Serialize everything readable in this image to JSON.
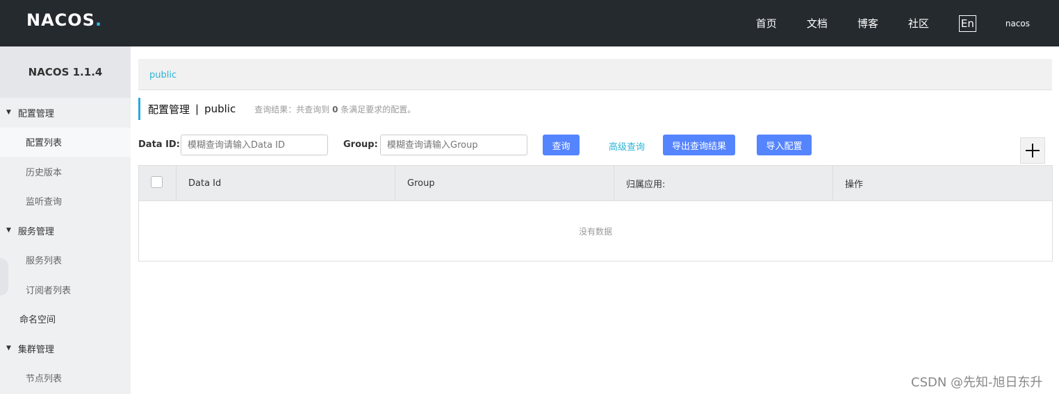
{
  "header": {
    "logo_text": "NACOS",
    "logo_dot": ".",
    "nav": [
      "首页",
      "文档",
      "博客",
      "社区"
    ],
    "lang": "En",
    "user": "nacos"
  },
  "sidebar": {
    "version": "NACOS 1.1.4",
    "menu": {
      "config_group": "配置管理",
      "config_list": "配置列表",
      "history": "历史版本",
      "listen_query": "监听查询",
      "service_group": "服务管理",
      "service_list": "服务列表",
      "subscribers": "订阅者列表",
      "namespace": "命名空间",
      "cluster_group": "集群管理",
      "node_list": "节点列表"
    }
  },
  "main": {
    "breadcrumb": "public",
    "title": "配置管理",
    "title_sep": "|",
    "namespace": "public",
    "result_prefix": "查询结果：共查询到",
    "result_count": "0",
    "result_suffix": "条满足要求的配置。",
    "form": {
      "dataid_label": "Data ID:",
      "dataid_placeholder": "模糊查询请输入Data ID",
      "group_label": "Group:",
      "group_placeholder": "模糊查询请输入Group",
      "query_btn": "查询",
      "advanced": "高级查询",
      "export_btn": "导出查询结果",
      "import_btn": "导入配置",
      "add_icon": "plus-icon"
    },
    "table": {
      "columns": [
        "Data Id",
        "Group",
        "归属应用:",
        "操作"
      ],
      "empty_text": "没有数据"
    }
  },
  "watermark": "CSDN @先知-旭日东升",
  "colors": {
    "header_bg": "#252a2f",
    "primary": "#5584ff",
    "link": "#2cb4d6"
  }
}
